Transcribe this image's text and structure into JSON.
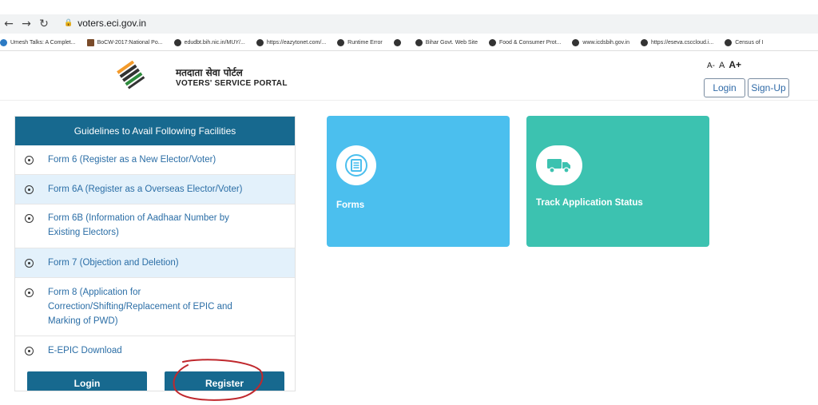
{
  "browser": {
    "url": "voters.eci.gov.in",
    "bookmarks": [
      "Umesh Talks: A Complet...",
      "BoCW-2017:National Po...",
      "edudbt.bih.nic.in/MUY/...",
      "https://eazytonet.com/...",
      "Runtime Error",
      "",
      "Bihar Govt. Web Site",
      "Food & Consumer Prot...",
      "www.icdsbih.gov.in",
      "https://eseva.csccloud.i...",
      "Census of I"
    ]
  },
  "header": {
    "title_hindi": "मतदाता सेवा पोर्टल",
    "title_en": "VOTERS' SERVICE PORTAL",
    "font_sizes": [
      "A-",
      "A",
      "A+"
    ],
    "login_label": "Login",
    "signup_label": "Sign-Up"
  },
  "guidelines": {
    "heading": "Guidelines to Avail Following Facilities",
    "items": [
      "Form 6 (Register as a New Elector/Voter)",
      "Form 6A (Register as a Overseas Elector/Voter)",
      "Form 6B (Information of Aadhaar Number by Existing Electors)",
      "Form 7 (Objection and Deletion)",
      "Form 8 (Application for Correction/Shifting/Replacement of EPIC and Marking of PWD)",
      "E-EPIC Download"
    ],
    "login_label": "Login",
    "register_label": "Register"
  },
  "cards": {
    "forms_label": "Forms",
    "track_label": "Track Application Status"
  },
  "colors": {
    "panel_header": "#17698f",
    "forms_card": "#4bbfee",
    "track_card": "#3cc2b0",
    "annotation": "#c0282d"
  }
}
